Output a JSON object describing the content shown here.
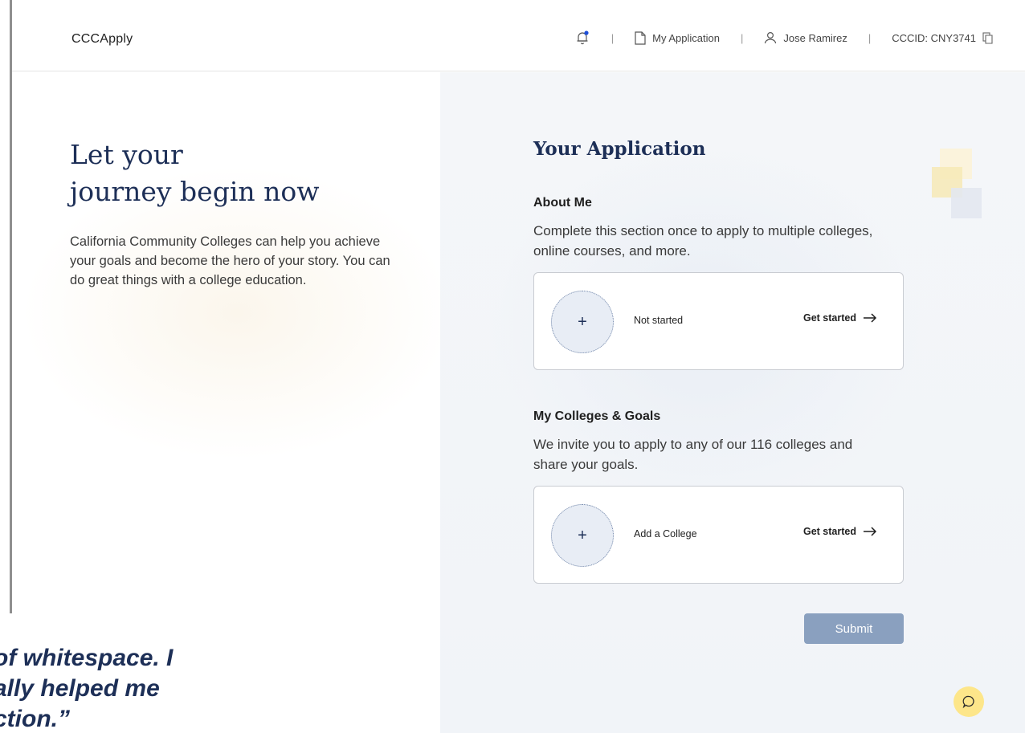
{
  "header": {
    "brand": "CCCApply",
    "separator": "|",
    "my_application": "My Application",
    "user_name": "Jose Ramirez",
    "cccid": "CCCID: CNY3741"
  },
  "hero": {
    "title_line1": "Let your",
    "title_line2": "journey begin now",
    "body": "California Community Colleges can help you achieve your goals and become the hero of your story. You can do great things with a college education."
  },
  "application": {
    "title": "Your Application",
    "about_me": {
      "title": "About Me",
      "description": "Complete this section once to apply to multiple colleges, online courses, and more.",
      "plus": "+",
      "status": "Not started",
      "cta": "Get started"
    },
    "colleges": {
      "title": "My Colleges & Goals",
      "description": "We invite you to apply to any of our 116 colleges and share your goals.",
      "plus": "+",
      "status": "Add a College",
      "cta": "Get started"
    },
    "submit_label": "Submit"
  },
  "quote": {
    "line1": "of whitespace. I",
    "line2": "ally helped me",
    "line3": "ction.”"
  },
  "colors": {
    "navy": "#1d2f57",
    "submit": "#8aa0bf",
    "chat": "#fde68a",
    "notification_dot": "#1d4ed8"
  },
  "icons": {
    "bell": "bell-icon",
    "document": "document-icon",
    "user": "user-icon",
    "copy": "copy-icon",
    "arrow": "arrow-right-icon",
    "chat": "chat-icon"
  }
}
